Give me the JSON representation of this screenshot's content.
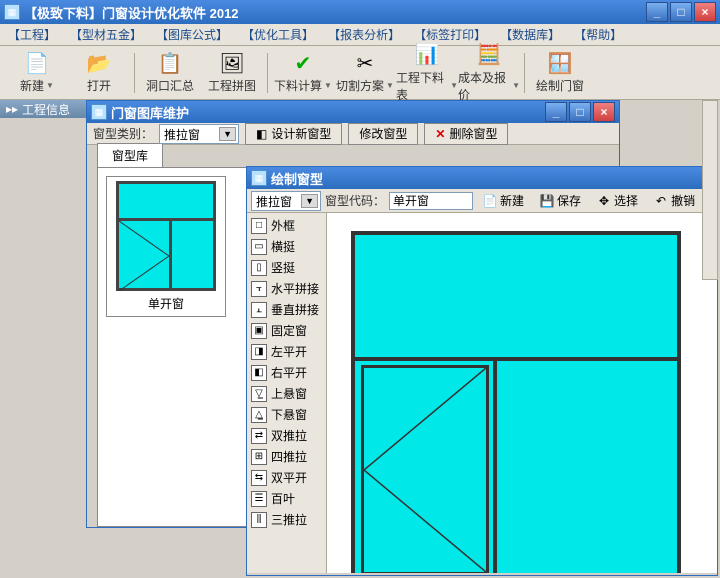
{
  "main": {
    "title": "【极致下料】门窗设计优化软件 2012",
    "menu": [
      "【工程】",
      "【型材五金】",
      "【图库公式】",
      "【优化工具】",
      "【报表分析】",
      "【标签打印】",
      "【数据库】",
      "【帮助】"
    ],
    "tools": [
      {
        "icon": "📄",
        "label": "新建",
        "dd": true
      },
      {
        "icon": "📂",
        "label": "打开",
        "dd": false
      },
      {
        "icon": "📋",
        "label": "洞口汇总",
        "dd": false
      },
      {
        "icon": "🖼",
        "label": "工程拼图",
        "dd": false
      },
      {
        "icon": "✔",
        "label": "下料计算",
        "dd": true,
        "green": true
      },
      {
        "icon": "✂",
        "label": "切割方案",
        "dd": true
      },
      {
        "icon": "📊",
        "label": "工程下料表",
        "dd": true
      },
      {
        "icon": "🧮",
        "label": "成本及报价",
        "dd": true
      },
      {
        "icon": "🪟",
        "label": "绘制门窗",
        "dd": false
      }
    ],
    "leftpane_title": "工程信息"
  },
  "libwin": {
    "title": "门窗图库维护",
    "type_label": "窗型类别：",
    "type_value": "推拉窗",
    "btn_design": "设计新窗型",
    "btn_modify": "修改窗型",
    "btn_delete": "删除窗型",
    "tab": "窗型库",
    "thumb_name": "单开窗"
  },
  "draw": {
    "title": "绘制窗型",
    "code_label": "窗型代码：",
    "code_value": "单开窗",
    "btn_new": "新建",
    "btn_save": "保存",
    "btn_select": "选择",
    "btn_undo": "撤销",
    "type_value": "推拉窗",
    "tools": [
      "外框",
      "横挺",
      "竖挺",
      "水平拼接",
      "垂直拼接",
      "固定窗",
      "左平开",
      "右平开",
      "上悬窗",
      "下悬窗",
      "双推拉",
      "四推拉",
      "双平开",
      "百叶",
      "三推拉"
    ]
  }
}
